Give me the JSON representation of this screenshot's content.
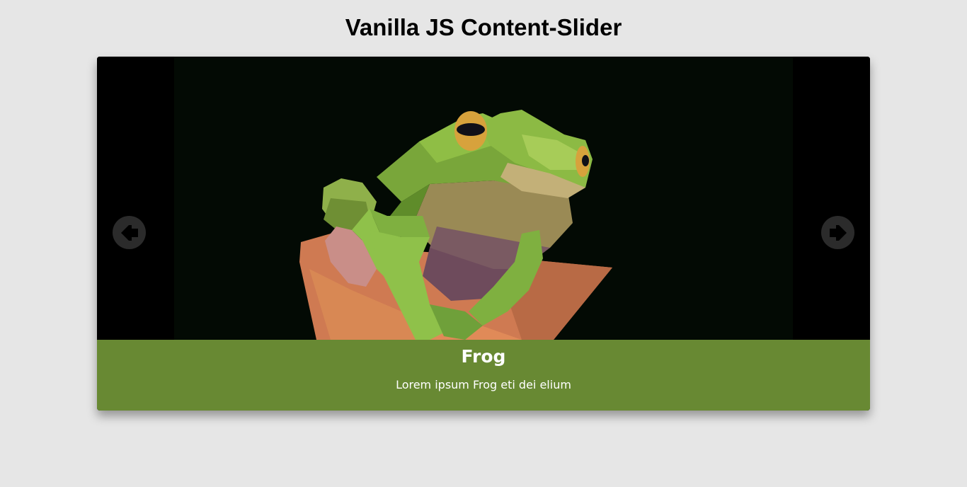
{
  "page": {
    "title": "Vanilla JS Content-Slider"
  },
  "slider": {
    "current_slide": {
      "title": "Frog",
      "description": "Lorem ipsum Frog eti dei elium",
      "image_subject": "low-poly-frog-illustration",
      "caption_color": "#688933"
    },
    "prev_icon": "arrow-left-icon",
    "next_icon": "arrow-right-icon"
  },
  "colors": {
    "page_background": "#e6e6e6",
    "caption_background": "#688933",
    "nav_button": "#2b2b2b"
  }
}
